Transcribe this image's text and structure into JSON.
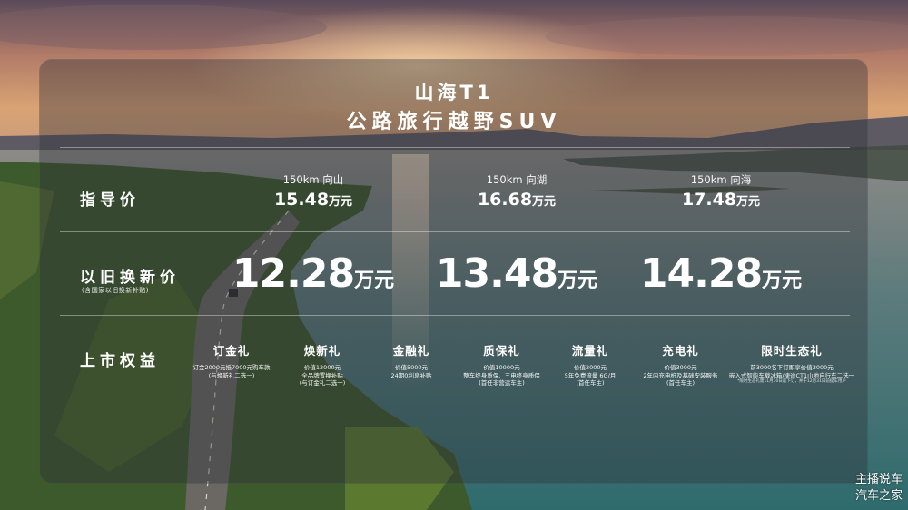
{
  "header": {
    "model": "山海T1",
    "subtitle": "公路旅行越野SUV"
  },
  "msrp": {
    "label": "指导价",
    "trims": [
      {
        "name": "150km 向山",
        "price": "15.48",
        "unit": "万元"
      },
      {
        "name": "150km 向湖",
        "price": "16.68",
        "unit": "万元"
      },
      {
        "name": "150km 向海",
        "price": "17.48",
        "unit": "万元"
      }
    ]
  },
  "tradein": {
    "label": "以旧换新价",
    "note": "(含国家以旧换新补贴)",
    "prices": [
      {
        "price": "12.28",
        "unit": "万元"
      },
      {
        "price": "13.48",
        "unit": "万元"
      },
      {
        "price": "14.28",
        "unit": "万元"
      }
    ]
  },
  "benefits": {
    "label": "上市权益",
    "items": [
      {
        "title": "订金礼",
        "lines": [
          "订金2000元抵7000元购车款",
          "(与焕新礼二选一)"
        ]
      },
      {
        "title": "焕新礼",
        "lines": [
          "价值12000元",
          "全品牌置换补贴",
          "(与订金礼二选一)"
        ]
      },
      {
        "title": "金融礼",
        "lines": [
          "价值5000元",
          "24期0利息补贴"
        ]
      },
      {
        "title": "质保礼",
        "lines": [
          "价值10000元",
          "整车终身质保、三电终身质保",
          "(首任非营运车主)"
        ]
      },
      {
        "title": "流量礼",
        "lines": [
          "价值2000元",
          "5年免费流量 6G/月",
          "(首任车主)"
        ]
      },
      {
        "title": "充电礼",
        "lines": [
          "价值3000元",
          "2年内充电桩及基础安装服务",
          "(首任车主)"
        ]
      },
      {
        "title": "限时生态礼",
        "lines": [
          "前3000名下订即享价值3000元",
          "嵌入式智能车载冰箱/捷途CT1山地自行车二选一"
        ],
        "note": "*限时生态礼需11月30日前下订，并于12月31日前提车用户"
      }
    ]
  },
  "watermark": {
    "line1": "主播说车",
    "line2": "汽车之家"
  },
  "colors": {
    "panel": "#2d3037",
    "text": "#ffffff"
  }
}
